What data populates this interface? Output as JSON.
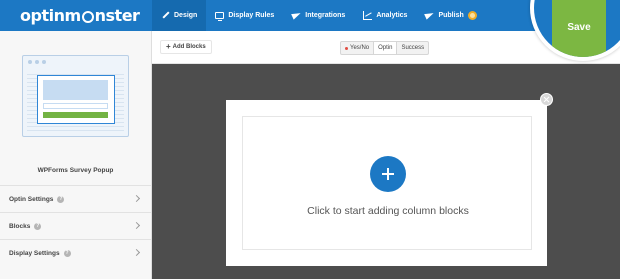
{
  "app": {
    "logo_prefix": "optinm",
    "logo_suffix": "nster"
  },
  "nav": {
    "items": [
      {
        "label": "Design",
        "icon": "pencil-icon"
      },
      {
        "label": "Display Rules",
        "icon": "monitor-icon"
      },
      {
        "label": "Integrations",
        "icon": "paper-plane-icon"
      },
      {
        "label": "Analytics",
        "icon": "chart-icon"
      },
      {
        "label": "Publish",
        "icon": "paper-plane-icon"
      }
    ],
    "save_label": "Save"
  },
  "sidebar": {
    "campaign_name": "WPForms Survey Popup",
    "items": [
      {
        "label": "Optin Settings"
      },
      {
        "label": "Blocks"
      },
      {
        "label": "Display Settings"
      }
    ]
  },
  "toolbar": {
    "add_blocks_label": "Add Blocks",
    "view_tabs": [
      {
        "label": "Yes/No"
      },
      {
        "label": "Optin"
      },
      {
        "label": "Success"
      }
    ]
  },
  "canvas": {
    "dropzone_text": "Click to start adding column blocks"
  },
  "colors": {
    "brand_blue": "#1c78c4",
    "save_green": "#7cb742",
    "canvas_bg": "#4d4d4d"
  }
}
